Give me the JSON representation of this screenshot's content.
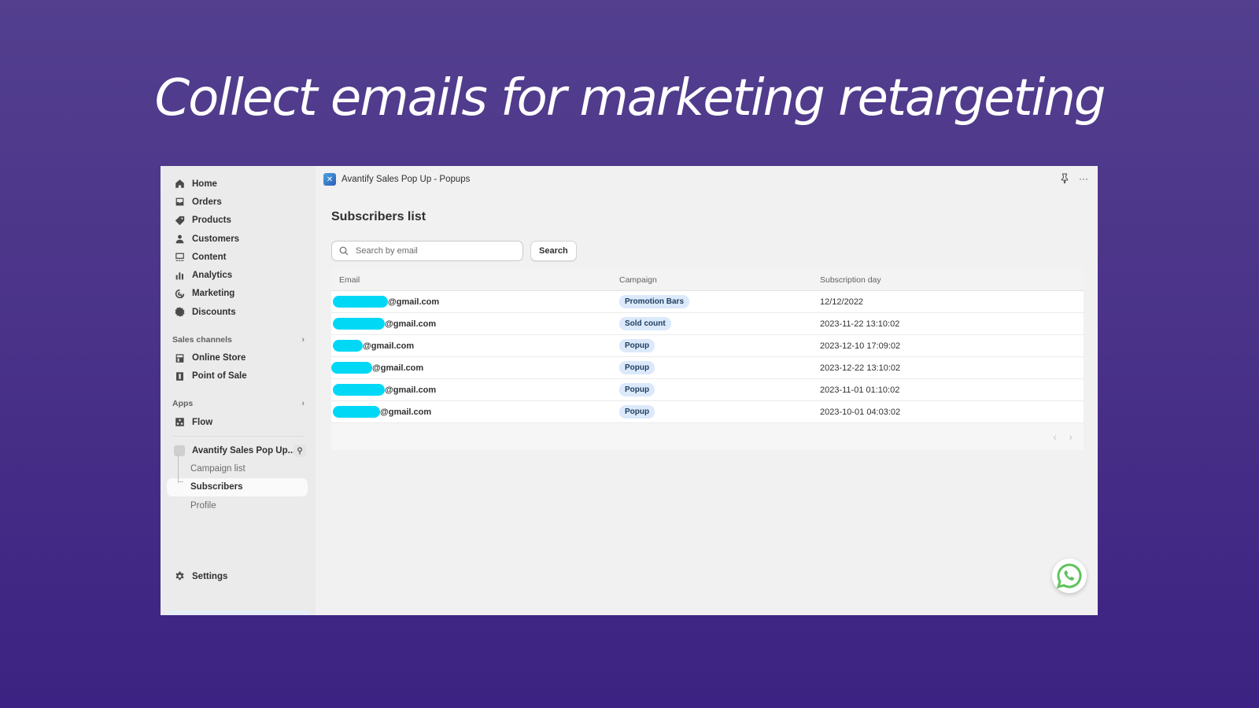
{
  "headline": "Collect emails for marketing retargeting",
  "sidebar": {
    "nav": [
      {
        "label": "Home",
        "icon": "home-icon"
      },
      {
        "label": "Orders",
        "icon": "inbox-icon"
      },
      {
        "label": "Products",
        "icon": "tag-icon"
      },
      {
        "label": "Customers",
        "icon": "person-icon"
      },
      {
        "label": "Content",
        "icon": "content-icon"
      },
      {
        "label": "Analytics",
        "icon": "bar-chart-icon"
      },
      {
        "label": "Marketing",
        "icon": "target-icon"
      },
      {
        "label": "Discounts",
        "icon": "discount-icon"
      }
    ],
    "sales_channels": {
      "title": "Sales channels",
      "items": [
        {
          "label": "Online Store",
          "icon": "store-icon"
        },
        {
          "label": "Point of Sale",
          "icon": "pos-icon"
        }
      ]
    },
    "apps": {
      "title": "Apps",
      "items": [
        {
          "label": "Flow",
          "icon": "flow-icon"
        }
      ]
    },
    "app": {
      "label": "Avantify Sales Pop Up...",
      "sub_items": [
        {
          "label": "Campaign list",
          "active": false
        },
        {
          "label": "Subscribers",
          "active": true
        },
        {
          "label": "Profile",
          "active": false
        }
      ]
    },
    "settings": "Settings"
  },
  "topbar": {
    "title": "Avantify Sales Pop Up - Popups",
    "more": "···"
  },
  "page": {
    "title": "Subscribers list",
    "search": {
      "placeholder": "Search by email",
      "value": "",
      "button": "Search"
    },
    "table": {
      "headers": [
        "Email",
        "Campaign",
        "Subscription day"
      ],
      "rows": [
        {
          "email": "@gmail.com",
          "campaign": "Promotion Bars",
          "date": "12/12/2022"
        },
        {
          "email": "@gmail.com",
          "campaign": "Sold count",
          "date": "2023-11-22 13:10:02"
        },
        {
          "email": "@gmail.com",
          "campaign": "Popup",
          "date": "2023-12-10 17:09:02"
        },
        {
          "email": "@gmail.com",
          "campaign": "Popup",
          "date": "2023-12-22 13:10:02"
        },
        {
          "email": "@gmail.com",
          "campaign": "Popup",
          "date": "2023-11-01 01:10:02"
        },
        {
          "email": "@gmail.com",
          "campaign": "Popup",
          "date": "2023-10-01 04:03:02"
        }
      ]
    },
    "pagination": {
      "prev": "‹",
      "next": "›"
    }
  },
  "colors": {
    "redaction": "#00d8f6",
    "badge_bg": "#dbe9fb",
    "whatsapp": "#5fc35b"
  }
}
